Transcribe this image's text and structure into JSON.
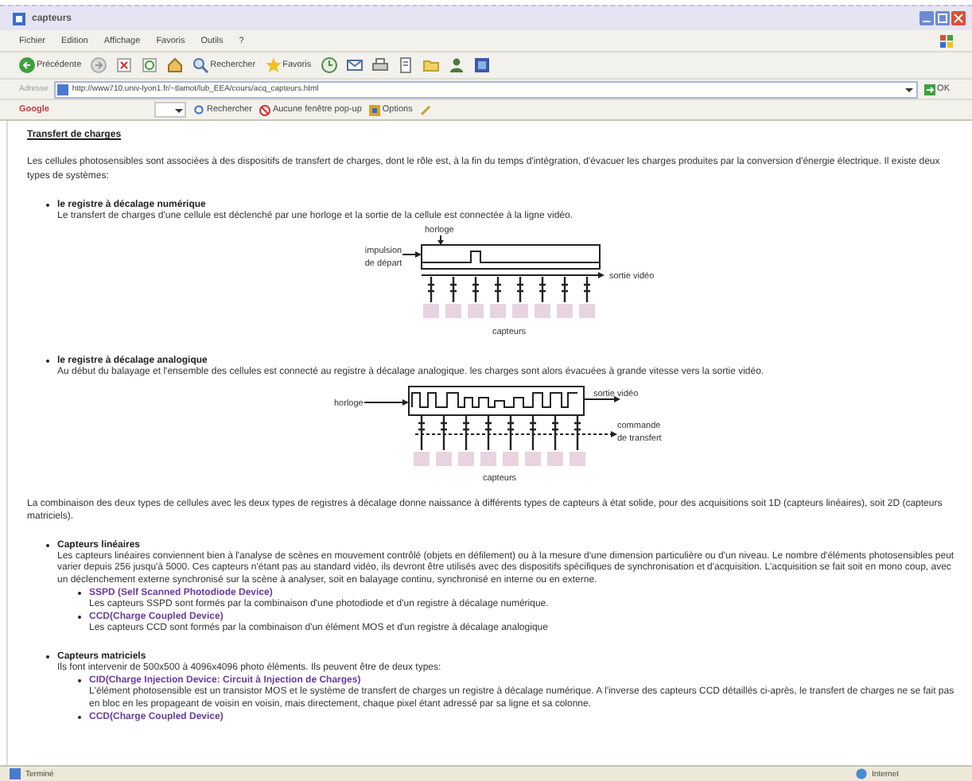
{
  "window": {
    "title": "capteurs"
  },
  "menu": [
    "Fichier",
    "Edition",
    "Affichage",
    "Favoris",
    "Outils",
    "?"
  ],
  "toolbar": {
    "buttons": [
      {
        "kind": "back",
        "label": "Précédente"
      },
      {
        "kind": "forward"
      },
      {
        "kind": "stop"
      },
      {
        "kind": "refresh"
      },
      {
        "kind": "home"
      },
      {
        "kind": "search",
        "label": "Rechercher"
      },
      {
        "kind": "favorites",
        "label": "Favoris"
      },
      {
        "kind": "history"
      },
      {
        "kind": "mail"
      },
      {
        "kind": "print"
      },
      {
        "kind": "edit"
      },
      {
        "kind": "folder"
      },
      {
        "kind": "messenger"
      },
      {
        "kind": "media"
      }
    ]
  },
  "address_bar": {
    "label": "Adresse",
    "url": "http://www710.univ-lyon1.fr/~tlamot/lub_EEA/cours/acq_capteurs.html",
    "go": "OK"
  },
  "google_bar": {
    "logo": "Google",
    "search": "Rechercher",
    "popup": "Aucune fenêtre pop-up",
    "options": "Options"
  },
  "content": {
    "heading": "Transfert de charges",
    "intro": "Les cellules photosensibles sont associées à des dispositifs de transfert de charges, dont le rôle est, à la fin du temps d'intégration, d'évacuer les charges produites par la conversion d'énergie électrique. Il existe deux types de systèmes:",
    "systems": [
      {
        "title": "le registre à décalage numérique",
        "text": "Le transfert de charges d'une cellule est déclenché par une horloge et la sortie de la cellule est connectée à la ligne vidéo.",
        "diagram": {
          "kind": "digital",
          "clock": "horloge",
          "start": [
            "impulsion",
            "de départ"
          ],
          "output": "sortie vidéo",
          "sensors": "capteurs"
        }
      },
      {
        "title": "le registre à décalage analogique",
        "text": "Au début du balayage et l'ensemble des cellules est connecté au registre à décalage analogique. les charges sont alors évacuées à grande vitesse vers la sortie vidéo.",
        "diagram": {
          "kind": "analog",
          "clock": "horloge",
          "output": "sortie vidéo",
          "transfer": [
            "commande",
            "de transfert"
          ],
          "sensors": "capteurs"
        }
      }
    ],
    "summary": "La combinaison des deux types de cellules avec les deux types de registres à décalage donne naissance à différents types de capteurs à état solide, pour des acquisitions soit 1D (capteurs linéaires), soit 2D (capteurs matriciels).",
    "sensor_types": [
      {
        "title": "Capteurs linéaires",
        "text": "Les capteurs linéaires conviennent bien à l'analyse de scènes en mouvement contrôlé (objets en défilement) ou à la mesure d'une dimension particulière ou d'un niveau. Le nombre d'éléments photosensibles peut varier depuis 256 jusqu'à 5000. Ces capteurs n'étant pas au standard vidéo, ils devront être utilisés avec des dispositifs spécifiques de synchronisation et d'acquisition. L'acquisition se fait soit en mono coup, avec un déclenchement externe synchronisé sur la scène à analyser, soit en balayage continu, synchronisé en interne ou en externe.",
        "subtypes": [
          {
            "title": "SSPD (Self Scanned Photodiode Device)",
            "text": "Les capteurs SSPD sont formés par la combinaison d'une photodiode et d'un registre à décalage numérique."
          },
          {
            "title": "CCD(Charge Coupled Device)",
            "text": "Les capteurs CCD sont formés par la combinaison d'un élément MOS et d'un registre à décalage analogique"
          }
        ]
      },
      {
        "title": "Capteurs matriciels",
        "text": "Ils font intervenir de 500x500 à 4096x4096 photo éléments. Ils peuvent être de deux types:",
        "subtypes": [
          {
            "title": "CID(Charge Injection Device: Circuit à Injection de Charges)",
            "text": "L'élément photosensible est un transistor MOS et le système de transfert de charges un registre à décalage numérique. A l'inverse des capteurs CCD détaillés ci-après, le transfert de charges ne se fait pas en bloc en les propageant de voisin en voisin, mais directement, chaque pixel étant adressé par sa ligne et sa colonne."
          },
          {
            "title": "CCD(Charge Coupled Device)"
          }
        ]
      }
    ]
  },
  "status_bar": {
    "left": "Terminé",
    "right": "Internet"
  }
}
